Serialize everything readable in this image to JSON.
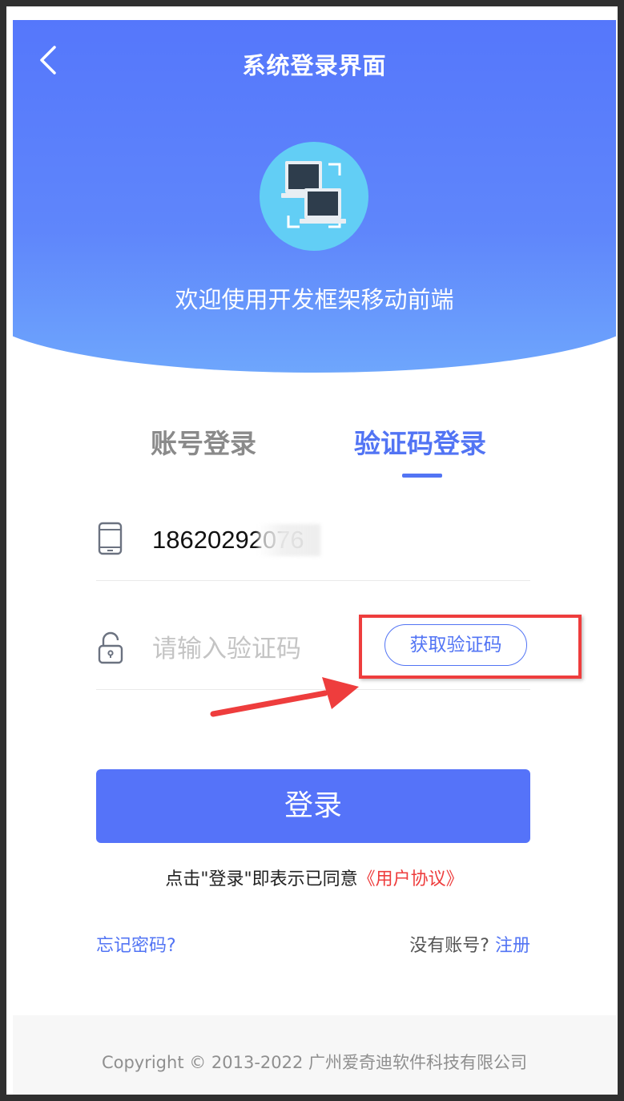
{
  "header": {
    "title": "系统登录界面",
    "back_icon": "chevron-left-icon"
  },
  "hero": {
    "logo_icon": "computers-icon",
    "welcome_text": "欢迎使用开发框架移动前端",
    "gradient_top": "#5577fb",
    "gradient_bottom": "#6ea6fc"
  },
  "tabs": [
    {
      "label": "账号登录",
      "active": false
    },
    {
      "label": "验证码登录",
      "active": true
    }
  ],
  "form": {
    "phone_icon": "mobile-phone-icon",
    "phone_value": "18620292076",
    "code_icon": "lock-icon",
    "code_placeholder": "请输入验证码",
    "get_code_label": "获取验证码"
  },
  "login_button": {
    "label": "登录"
  },
  "agreement": {
    "prefix": "点击\"登录\"即表示已同意",
    "link": "《用户协议》"
  },
  "links": {
    "forgot": "忘记密码?",
    "no_account": "没有账号?",
    "register": "注册"
  },
  "footer": {
    "copyright": "Copyright © 2013-2022 广州爱奇迪软件科技有限公司"
  },
  "colors": {
    "accent": "#5274f4",
    "button": "#5573f9",
    "highlight": "#ee3d3d"
  }
}
